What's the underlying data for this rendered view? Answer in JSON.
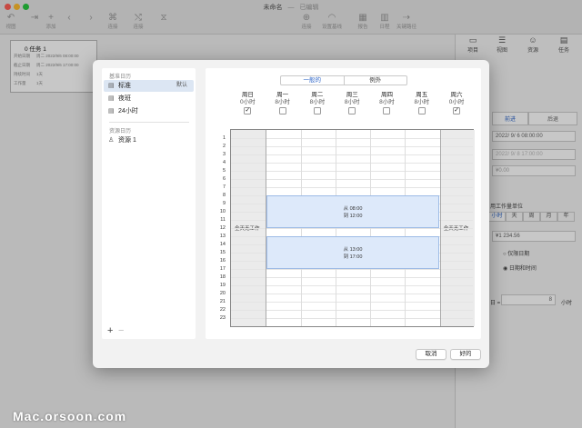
{
  "window": {
    "title": "未命名",
    "subtitle": "已编辑"
  },
  "toolbar": {
    "left": [
      {
        "label": "视图",
        "icon": "view-icon"
      },
      {
        "label": "",
        "icon": "outline-icon"
      },
      {
        "label": "添加",
        "icon": "plus-icon"
      },
      {
        "label": "",
        "icon": "back-icon"
      },
      {
        "label": "",
        "icon": "forward-icon"
      },
      {
        "label": "连接",
        "icon": "link-icon"
      },
      {
        "label": "连接",
        "icon": "shuffle-icon"
      },
      {
        "label": "",
        "icon": "hourglass-icon"
      }
    ],
    "right": [
      {
        "label": "连接",
        "icon": "connect-icon"
      },
      {
        "label": "设置基线",
        "icon": "baseline-icon"
      },
      {
        "label": "报告",
        "icon": "report-icon"
      },
      {
        "label": "日程",
        "icon": "schedule-icon"
      },
      {
        "label": "关键路径",
        "icon": "critical-path-icon"
      }
    ]
  },
  "task_card": {
    "title": "0 任务 1",
    "rows": [
      {
        "k": "开始日期",
        "v": "周二 2022/9/6 08:00:00"
      },
      {
        "k": "截止日期",
        "v": "周二 2022/9/6 17:00:00"
      },
      {
        "k": "持续时间",
        "v": "1天"
      },
      {
        "k": "工作量",
        "v": "1天"
      }
    ]
  },
  "inspector": {
    "tabs": [
      {
        "label": "项目",
        "icon": "project-icon"
      },
      {
        "label": "视图",
        "icon": "sliders-icon"
      },
      {
        "label": "资源",
        "icon": "people-icon"
      },
      {
        "label": "任务",
        "icon": "task-icon"
      }
    ],
    "seg_left": "前进",
    "seg_right": "后退",
    "date1": "2022/ 9/ 6 08:00:00",
    "date2": "2022/ 9/ 8 17:00:00",
    "cost1": "¥0.00",
    "unit_label": "用工作量单位",
    "units": [
      "小时",
      "天",
      "周",
      "月",
      "年"
    ],
    "cost2": "¥1 234.56",
    "radio1": "仅限日期",
    "radio2": "日期和时间",
    "hours_prefix": "日 =",
    "hours_value": "8",
    "hours_suffix": "小时"
  },
  "dialog": {
    "basic_header": "基准日历",
    "calendars": [
      {
        "name": "标准",
        "default": "默认",
        "icon": "calendar-icon"
      },
      {
        "name": "夜班",
        "default": "",
        "icon": "calendar-icon"
      },
      {
        "name": "24小时",
        "default": "",
        "icon": "calendar-icon"
      }
    ],
    "resource_header": "资源日历",
    "resources": [
      {
        "name": "资源 1",
        "icon": "person-icon"
      }
    ],
    "add": "+",
    "remove": "−",
    "tabs": [
      "一般的",
      "例外"
    ],
    "days": [
      {
        "name": "周日",
        "hours": "0小时",
        "checked": true
      },
      {
        "name": "周一",
        "hours": "8小时",
        "checked": false
      },
      {
        "name": "周二",
        "hours": "8小时",
        "checked": false
      },
      {
        "name": "周三",
        "hours": "8小时",
        "checked": false
      },
      {
        "name": "周四",
        "hours": "8小时",
        "checked": false
      },
      {
        "name": "周五",
        "hours": "8小时",
        "checked": false
      },
      {
        "name": "周六",
        "hours": "0小时",
        "checked": true
      }
    ],
    "hours": [
      "1",
      "2",
      "3",
      "4",
      "5",
      "6",
      "7",
      "8",
      "9",
      "10",
      "11",
      "12",
      "13",
      "14",
      "15",
      "16",
      "17",
      "18",
      "19",
      "20",
      "21",
      "22",
      "23"
    ],
    "nonwork_label": "全天无工作",
    "blocks": [
      {
        "from": "从 08:00",
        "to": "到 12:00",
        "start": 8,
        "end": 12
      },
      {
        "from": "从 13:00",
        "to": "到 17:00",
        "start": 13,
        "end": 17
      }
    ],
    "cancel": "取消",
    "ok": "好的"
  },
  "watermark": "Mac.orsoon.com"
}
